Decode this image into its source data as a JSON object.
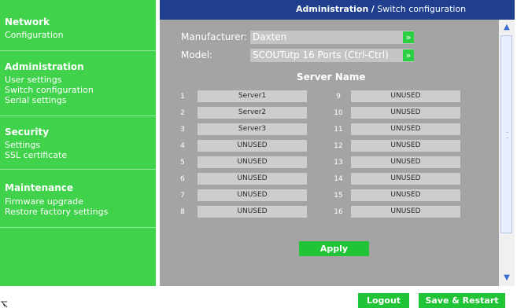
{
  "sidebar": {
    "sections": [
      {
        "title": "Network",
        "items": [
          "Configuration"
        ]
      },
      {
        "title": "Administration",
        "items": [
          "User settings",
          "Switch configuration",
          "Serial settings"
        ]
      },
      {
        "title": "Security",
        "items": [
          "Settings",
          "SSL certificate"
        ]
      },
      {
        "title": "Maintenance",
        "items": [
          "Firmware upgrade",
          "Restore factory settings"
        ]
      }
    ]
  },
  "header": {
    "section": "Administration",
    "separator": "/",
    "page": "Switch configuration"
  },
  "form": {
    "manufacturer_label": "Manufacturer:",
    "manufacturer_value": "Daxten",
    "model_label": "Model:",
    "model_value": "SCOUTutp 16 Ports (Ctrl-Ctrl)",
    "dropdown_glyph": "»"
  },
  "servers": {
    "title": "Server Name",
    "left": [
      {
        "num": "1",
        "name": "Server1"
      },
      {
        "num": "2",
        "name": "Server2"
      },
      {
        "num": "3",
        "name": "Server3"
      },
      {
        "num": "4",
        "name": "UNUSED"
      },
      {
        "num": "5",
        "name": "UNUSED"
      },
      {
        "num": "6",
        "name": "UNUSED"
      },
      {
        "num": "7",
        "name": "UNUSED"
      },
      {
        "num": "8",
        "name": "UNUSED"
      }
    ],
    "right": [
      {
        "num": "9",
        "name": "UNUSED"
      },
      {
        "num": "10",
        "name": "UNUSED"
      },
      {
        "num": "11",
        "name": "UNUSED"
      },
      {
        "num": "12",
        "name": "UNUSED"
      },
      {
        "num": "13",
        "name": "UNUSED"
      },
      {
        "num": "14",
        "name": "UNUSED"
      },
      {
        "num": "15",
        "name": "UNUSED"
      },
      {
        "num": "16",
        "name": "UNUSED"
      }
    ]
  },
  "buttons": {
    "apply": "Apply",
    "logout": "Logout",
    "save_restart": "Save & Restart"
  },
  "icons": {
    "scroll_up": "scroll-up-arrow-icon",
    "scroll_down": "scroll-down-arrow-icon",
    "corner": "corner-icon"
  },
  "colors": {
    "sidebar": "#3fd24a",
    "header": "#1f3e8e",
    "panel": "#a4a4a4",
    "button": "#22c437"
  }
}
